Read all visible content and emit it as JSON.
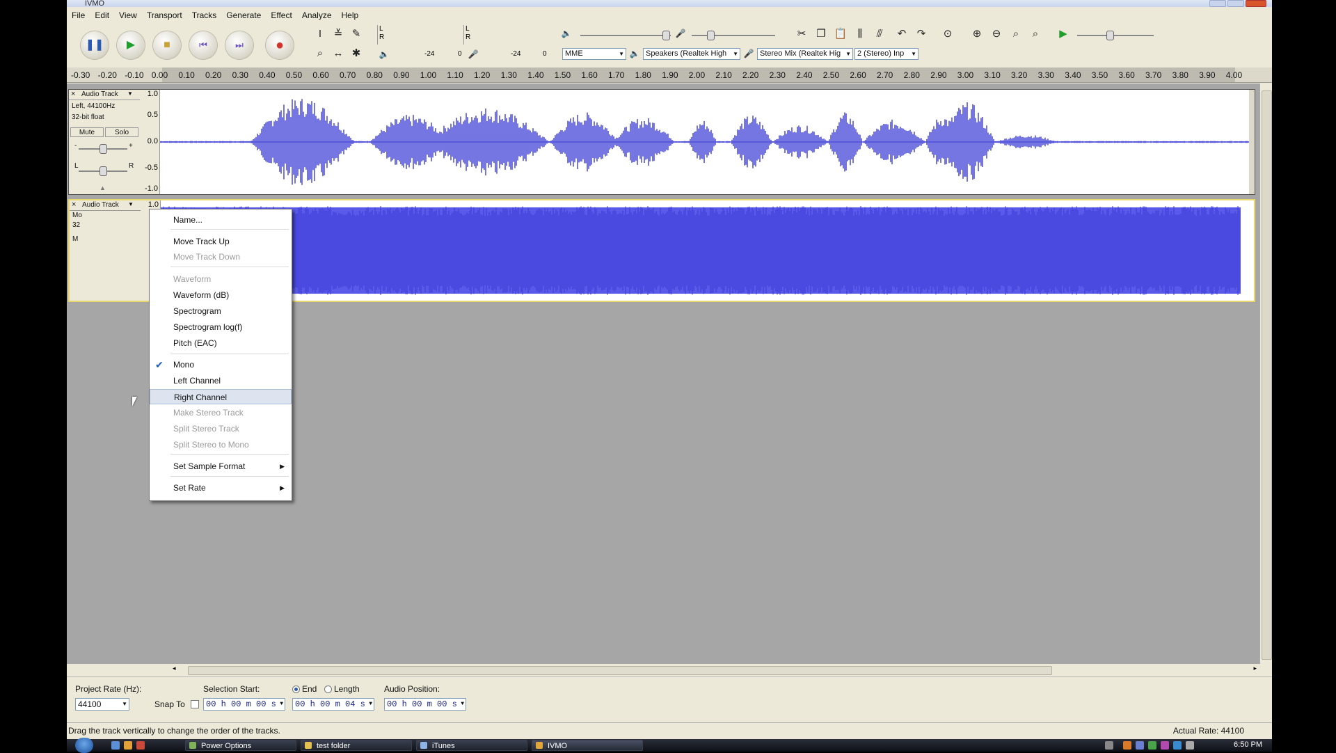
{
  "window": {
    "title": "IVMO"
  },
  "menubar": [
    "File",
    "Edit",
    "View",
    "Transport",
    "Tracks",
    "Generate",
    "Effect",
    "Analyze",
    "Help"
  ],
  "meters": {
    "left_label": "L",
    "right_label": "R",
    "play_min": "-24",
    "play_zero": "0",
    "rec_min": "-24",
    "rec_zero": "0"
  },
  "devices": {
    "host": "MME",
    "output": "Speakers (Realtek High",
    "input": "Stereo Mix (Realtek Hig",
    "channels": "2 (Stereo) Inp"
  },
  "ruler": {
    "ticks": [
      "-0.30",
      "-0.20",
      "-0.10",
      "0.00",
      "0.10",
      "0.20",
      "0.30",
      "0.40",
      "0.50",
      "0.60",
      "0.70",
      "0.80",
      "0.90",
      "1.00",
      "1.10",
      "1.20",
      "1.30",
      "1.40",
      "1.50",
      "1.60",
      "1.70",
      "1.80",
      "1.90",
      "2.00",
      "2.10",
      "2.20",
      "2.30",
      "2.40",
      "2.50",
      "2.60",
      "2.70",
      "2.80",
      "2.90",
      "3.00",
      "3.10",
      "3.20",
      "3.30",
      "3.40",
      "3.50",
      "3.60",
      "3.70",
      "3.80",
      "3.90",
      "4.00"
    ]
  },
  "track1": {
    "name": "Audio Track",
    "close": "×",
    "line1": "Left, 44100Hz",
    "line2": "32-bit float",
    "mute": "Mute",
    "solo": "Solo",
    "gain_minus": "-",
    "gain_plus": "+",
    "pan_l": "L",
    "pan_r": "R",
    "scale": [
      "1.0",
      "0.5",
      "0.0",
      "-0.5",
      "-1.0"
    ]
  },
  "track2": {
    "name": "Audio Track",
    "close": "×",
    "partial1": "Mo",
    "partial2": "32",
    "partial3": "M",
    "scale_top": "1.0"
  },
  "track_menu": {
    "items": [
      {
        "label": "Name...",
        "enabled": true
      },
      {
        "label": "Move Track Up",
        "enabled": true
      },
      {
        "label": "Move Track Down",
        "enabled": false
      },
      {
        "label": "Waveform",
        "enabled": false
      },
      {
        "label": "Waveform (dB)",
        "enabled": true
      },
      {
        "label": "Spectrogram",
        "enabled": true
      },
      {
        "label": "Spectrogram log(f)",
        "enabled": true
      },
      {
        "label": "Pitch (EAC)",
        "enabled": true
      },
      {
        "label": "Mono",
        "enabled": true,
        "checked": true
      },
      {
        "label": "Left Channel",
        "enabled": true
      },
      {
        "label": "Right Channel",
        "enabled": true,
        "highlighted": true
      },
      {
        "label": "Make Stereo Track",
        "enabled": false
      },
      {
        "label": "Split Stereo Track",
        "enabled": false
      },
      {
        "label": "Split Stereo to Mono",
        "enabled": false
      },
      {
        "label": "Set Sample Format",
        "enabled": true,
        "submenu": true
      },
      {
        "label": "Set Rate",
        "enabled": true,
        "submenu": true
      }
    ]
  },
  "bottom": {
    "project_rate_label": "Project Rate (Hz):",
    "project_rate_value": "44100",
    "snap_to_label": "Snap To",
    "selection_start_label": "Selection Start:",
    "end_label": "End",
    "length_label": "Length",
    "audio_position_label": "Audio Position:",
    "selection_start_value": "00 h 00 m 00 s",
    "selection_end_value": "00 h 00 m 04 s",
    "audio_position_value": "00 h 00 m 00 s"
  },
  "status": {
    "message": "Drag the track vertically to change the order of the tracks.",
    "actual_rate": "Actual Rate: 44100"
  },
  "taskbar": {
    "tasks": [
      "Power Options",
      "test folder",
      "iTunes",
      "IVMO"
    ],
    "clock": "6:50 PM"
  },
  "colors": {
    "waveform": "#3b3bd6",
    "selected_wave_bg": "#5a5aea",
    "track_highlight": "#e8d76a",
    "menu_highlight": "#dde4ef"
  }
}
